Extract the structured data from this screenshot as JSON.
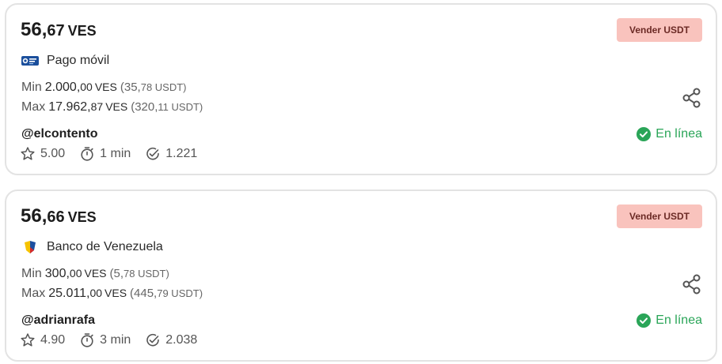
{
  "offers": [
    {
      "price_int": "56,",
      "price_dec": "67",
      "currency": "VES",
      "sell_label": "Vender USDT",
      "method_label": "Pago móvil",
      "method_icon": "pago-movil-logo",
      "min_label": "Min",
      "min_int": "2.000,",
      "min_dec": "00",
      "min_cur": "VES",
      "min_usdt_int": "(35,",
      "min_usdt_dec": "78 USDT)",
      "max_label": "Max",
      "max_int": "17.962,",
      "max_dec": "87",
      "max_cur": "VES",
      "max_usdt_int": "(320,",
      "max_usdt_dec": "11 USDT)",
      "username": "@elcontento",
      "status_label": "En línea",
      "rating": "5.00",
      "time": "1 min",
      "trades": "1.221"
    },
    {
      "price_int": "56,",
      "price_dec": "66",
      "currency": "VES",
      "sell_label": "Vender USDT",
      "method_label": "Banco de Venezuela",
      "method_icon": "banco-de-venezuela-logo",
      "min_label": "Min",
      "min_int": "300,",
      "min_dec": "00",
      "min_cur": "VES",
      "min_usdt_int": "(5,",
      "min_usdt_dec": "78 USDT)",
      "max_label": "Max",
      "max_int": "25.011,",
      "max_dec": "00",
      "max_cur": "VES",
      "max_usdt_int": "(445,",
      "max_usdt_dec": "79 USDT)",
      "username": "@adrianrafa",
      "status_label": "En línea",
      "rating": "4.90",
      "time": "3 min",
      "trades": "2.038"
    }
  ],
  "colors": {
    "sell_button_bg": "#f9c3bd",
    "sell_button_text": "#6b2a25",
    "online_green": "#2aa558",
    "border": "#e3e3e3"
  },
  "icons": [
    "share-icon",
    "check-circle-icon",
    "star-icon",
    "timer-icon",
    "check-badge-icon"
  ]
}
